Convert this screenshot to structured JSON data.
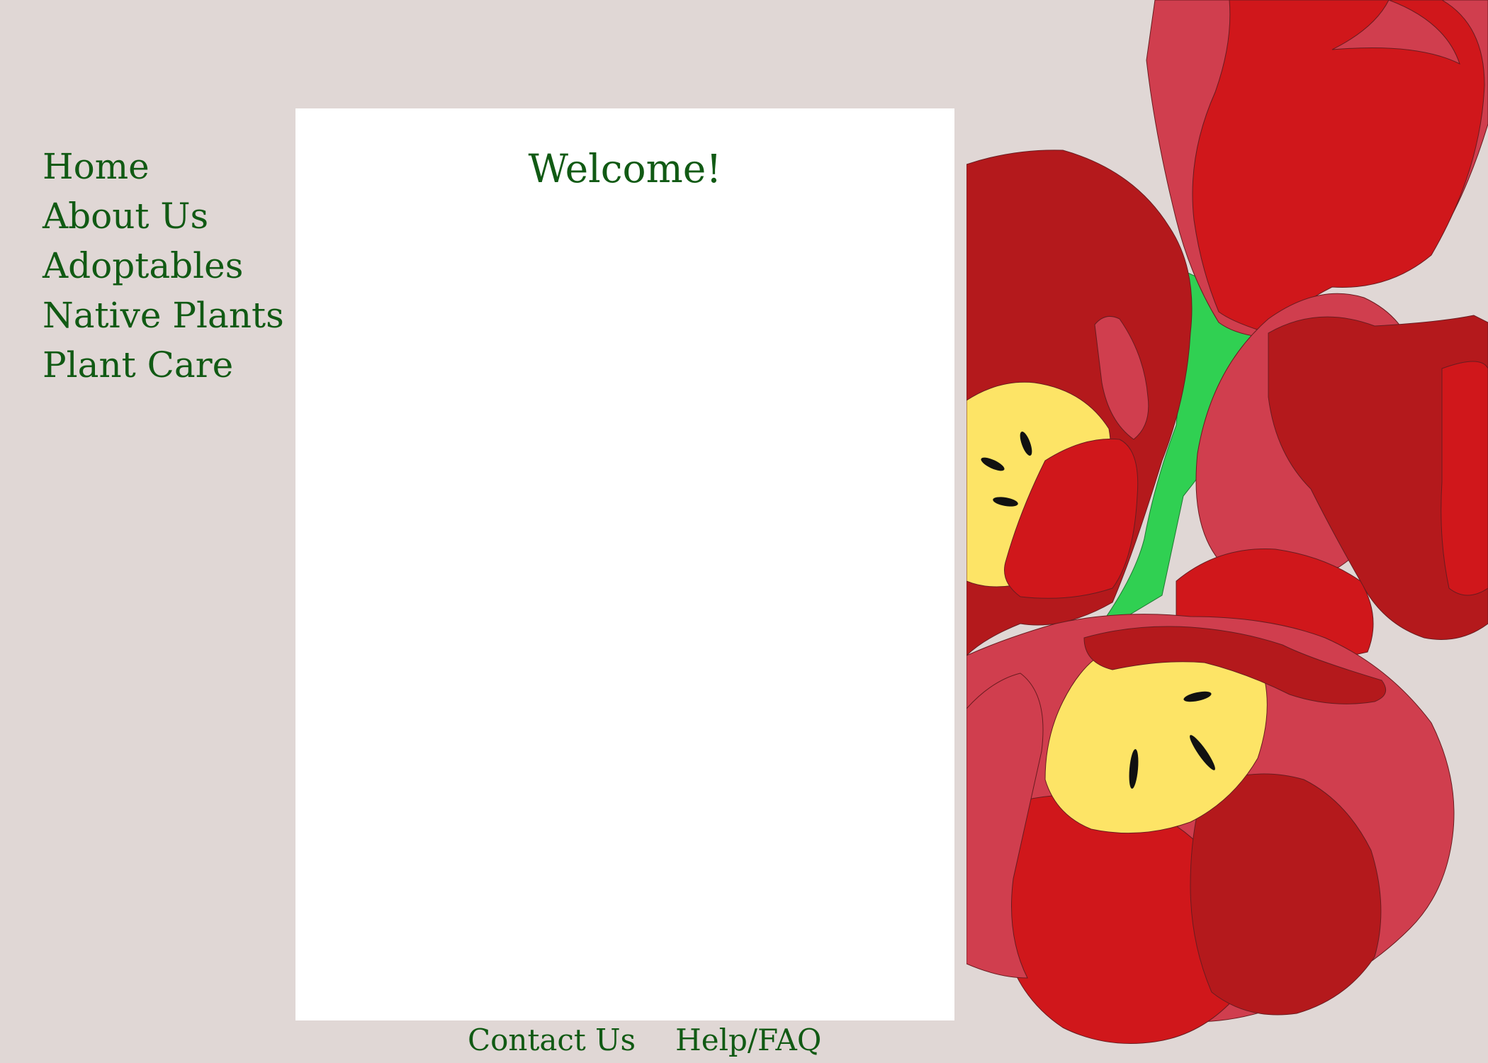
{
  "nav": {
    "items": [
      {
        "label": "Home"
      },
      {
        "label": "About Us"
      },
      {
        "label": "Adoptables"
      },
      {
        "label": "Native Plants"
      },
      {
        "label": "Plant Care"
      }
    ]
  },
  "main": {
    "heading": "Welcome!"
  },
  "footer": {
    "links": [
      {
        "label": "Contact Us"
      },
      {
        "label": "Help/FAQ"
      }
    ]
  },
  "decor": {
    "illustration": "red-tulips-illustration",
    "colors": {
      "background": "#e0d7d5",
      "panel": "#ffffff",
      "text": "#115a14",
      "petal_dark": "#b4191c",
      "petal_bright": "#d0171b",
      "petal_pink": "#d03e4e",
      "flower_center": "#fde466",
      "leaf": "#30d052"
    }
  }
}
